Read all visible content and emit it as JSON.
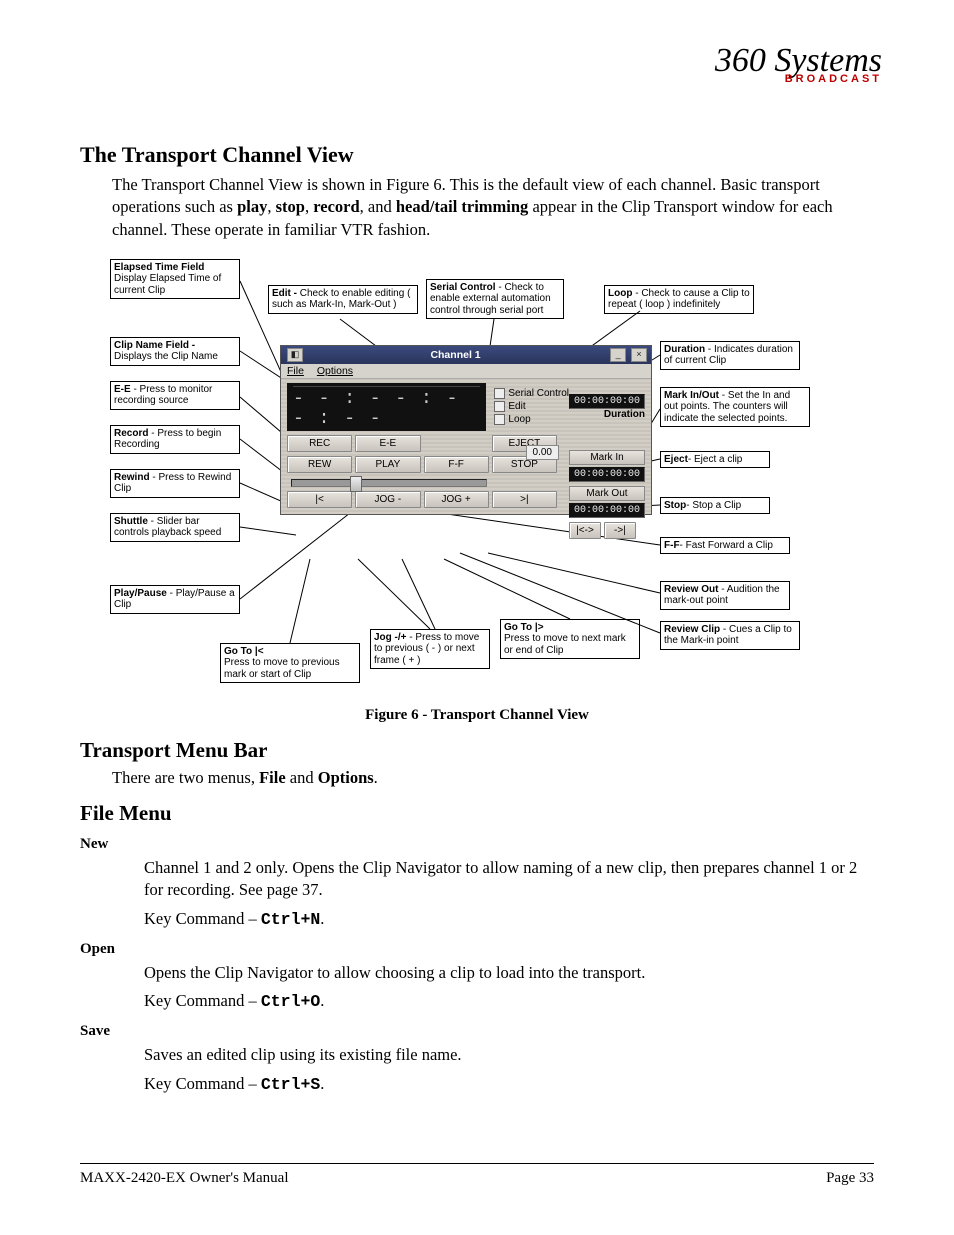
{
  "logo": {
    "script": "360 Systems",
    "sub": "BROADCAST"
  },
  "h1": "The Transport Channel View",
  "p1a": "The Transport Channel View is shown in Figure 6.  This is the default view of each channel. Basic transport operations such as ",
  "p1b_play": "play",
  "p1b_c1": ", ",
  "p1b_stop": "stop",
  "p1b_c2": ", ",
  "p1b_rec": "record",
  "p1b_c3": ", and ",
  "p1b_trim": "head/tail trimming",
  "p1c": " appear in the Clip Transport window for each channel.  These operate in familiar VTR fashion.",
  "figcaption": "Figure 6 - Transport Channel View",
  "callouts": {
    "elapsed_b": "Elapsed Time Field",
    "elapsed_t": "Display Elapsed Time of current Clip",
    "clipname_b": "Clip Name Field -",
    "clipname_t": "Displays the Clip Name",
    "ee_b": "E-E",
    "ee_t": " - Press to monitor recording source",
    "record_b": "Record",
    "record_t": " - Press to begin Recording",
    "rewind_b": "Rewind",
    "rewind_t": " - Press to Rewind Clip",
    "shuttle_b": "Shuttle",
    "shuttle_t": " - Slider bar controls playback speed",
    "play_b": "Play/Pause",
    "play_t": " - Play/Pause a Clip",
    "edit_b": "Edit -",
    "edit_t": " Check to enable editing ( such as Mark-In, Mark-Out )",
    "serial_b": "Serial Control",
    "serial_t": " - Check to enable external automation control through serial port",
    "loop_b": "Loop",
    "loop_t": " - Check to cause a Clip to repeat ( loop ) indefinitely",
    "duration_b": "Duration",
    "duration_t": " - Indicates duration of current Clip",
    "markio_b": "Mark In/Out",
    "markio_t": " - Set the In and out points. The counters will indicate the selected points.",
    "eject_b": "Eject",
    "eject_t": "- Eject a clip",
    "stop_b": "Stop",
    "stop_t": "- Stop a Clip",
    "ff_b": "F-F",
    "ff_t": "- Fast Forward a Clip",
    "revout_b": "Review Out",
    "revout_t": " - Audition the mark-out point",
    "revclip_b": "Review Clip",
    "revclip_t": " - Cues a Clip to the Mark-in point",
    "gotoend_b": "Go To |>",
    "gotoend_t": "Press to move to next mark or end of Clip",
    "jog_b": "Jog -/+",
    "jog_t": " - Press to move to previous ( - ) or next frame ( + )",
    "gotostart_b": "Go To |<",
    "gotostart_t": "Press to move to previous mark or start of Clip"
  },
  "panel": {
    "title": "Channel  1",
    "menu_file": "File",
    "menu_options": "Options",
    "time": "- - : - - : - - : - -",
    "chk_serial": "Serial Control",
    "chk_edit": "Edit",
    "chk_loop": "Loop",
    "dur_lbl": "Duration",
    "dur_val": "00:00:00:00",
    "markin_lbl": "Mark In",
    "markin_val": "00:00:00:00",
    "markout_lbl": "Mark Out",
    "markout_val": "00:00:00:00",
    "b_rec": "REC",
    "b_ee": "E-E",
    "b_eject": "EJECT",
    "b_rew": "REW",
    "b_play": "PLAY",
    "b_ff": "F-F",
    "b_stop": "STOP",
    "b_gostart": "|<",
    "b_jogm": "JOG -",
    "b_jogp": "JOG +",
    "b_goend": ">|",
    "b_revclip": "|<->",
    "b_revout": "->|",
    "speed": "0.00"
  },
  "h2": "Transport Menu Bar",
  "p2a": "There are two menus, ",
  "p2b_file": "File",
  "p2c": " and ",
  "p2d_opt": "Options",
  "p2e": ".",
  "h3": "File Menu",
  "new_h": "New",
  "new_p": "Channel 1 and 2 only.  Opens the Clip Navigator to allow naming of a new clip, then prepares channel 1 or 2 for recording. See page 37.",
  "new_k_a": "Key Command – ",
  "new_k_b": "Ctrl+N",
  "new_k_c": ".",
  "open_h": "Open",
  "open_p": "Opens the Clip Navigator to allow choosing a clip to load into the transport.",
  "open_k_a": "Key Command – ",
  "open_k_b": "Ctrl+O",
  "open_k_c": ".",
  "save_h": "Save",
  "save_p": "Saves an edited clip using its existing file name.",
  "save_k_a": "Key Command – ",
  "save_k_b": "Ctrl+S",
  "save_k_c": ".",
  "footer_left": "MAXX-2420-EX Owner's Manual",
  "footer_right": "Page 33"
}
